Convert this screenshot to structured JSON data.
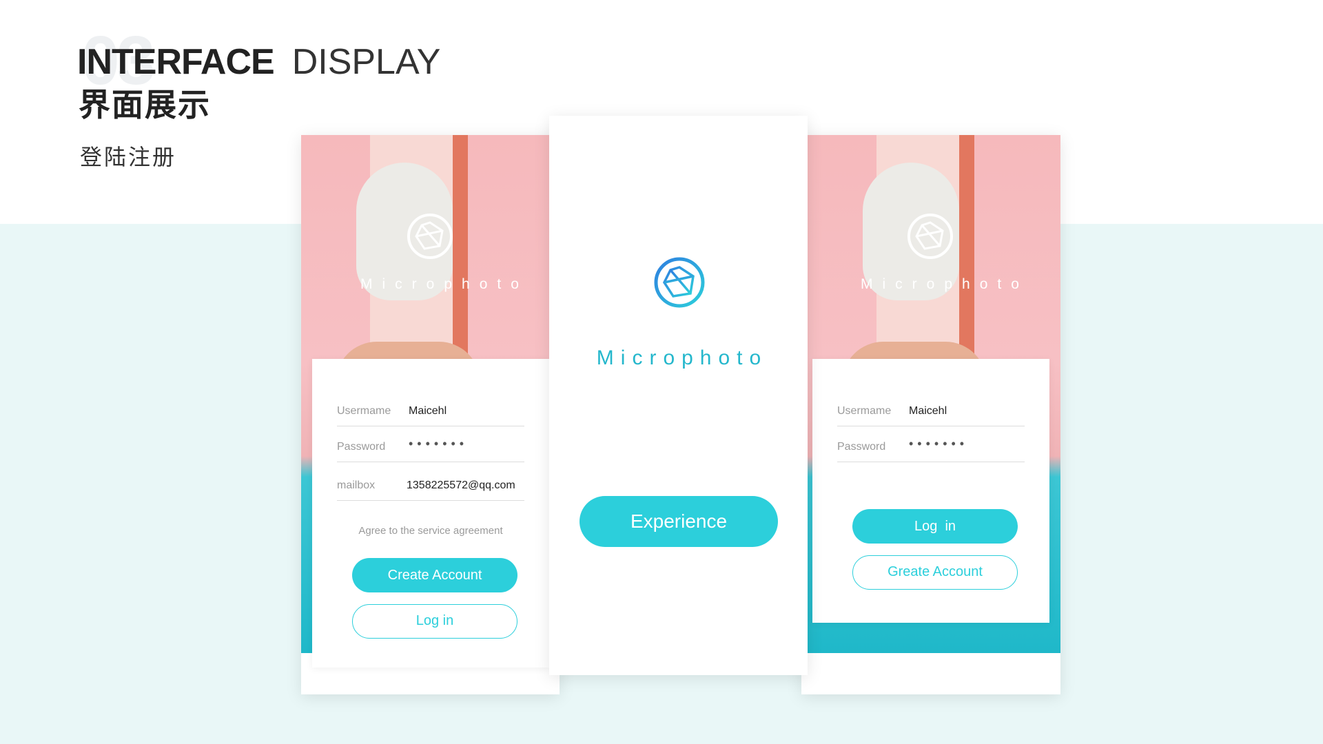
{
  "heading": {
    "number": "03",
    "title_bold": "INTERFACE",
    "title_light": "DISPLAY",
    "title_cn": "界面展示",
    "subtitle": "登陆注册"
  },
  "colors": {
    "accent": "#2ccfdb",
    "brand_text": "#24b7cc",
    "band": "#e9f7f7"
  },
  "register_screen": {
    "brand": "Microphoto",
    "logo_icon": "camera-aperture-icon",
    "fields": [
      {
        "label": "Usermame",
        "value": "Maicehl"
      },
      {
        "label": "Password",
        "value": "•••••••"
      },
      {
        "label": "mailbox",
        "value": "1358225572@qq.com"
      }
    ],
    "agreement": "Agree to the service agreement",
    "primary_button": "Create Account",
    "secondary_button": "Log in"
  },
  "splash_screen": {
    "brand": "Microphoto",
    "logo_icon": "camera-aperture-icon",
    "button": "Experience"
  },
  "login_screen": {
    "brand": "Microphoto",
    "logo_icon": "camera-aperture-icon",
    "fields": [
      {
        "label": "Usermame",
        "value": "Maicehl"
      },
      {
        "label": "Password",
        "value": "•••••••"
      }
    ],
    "primary_button": "Log  in",
    "secondary_button": "Greate Account"
  }
}
